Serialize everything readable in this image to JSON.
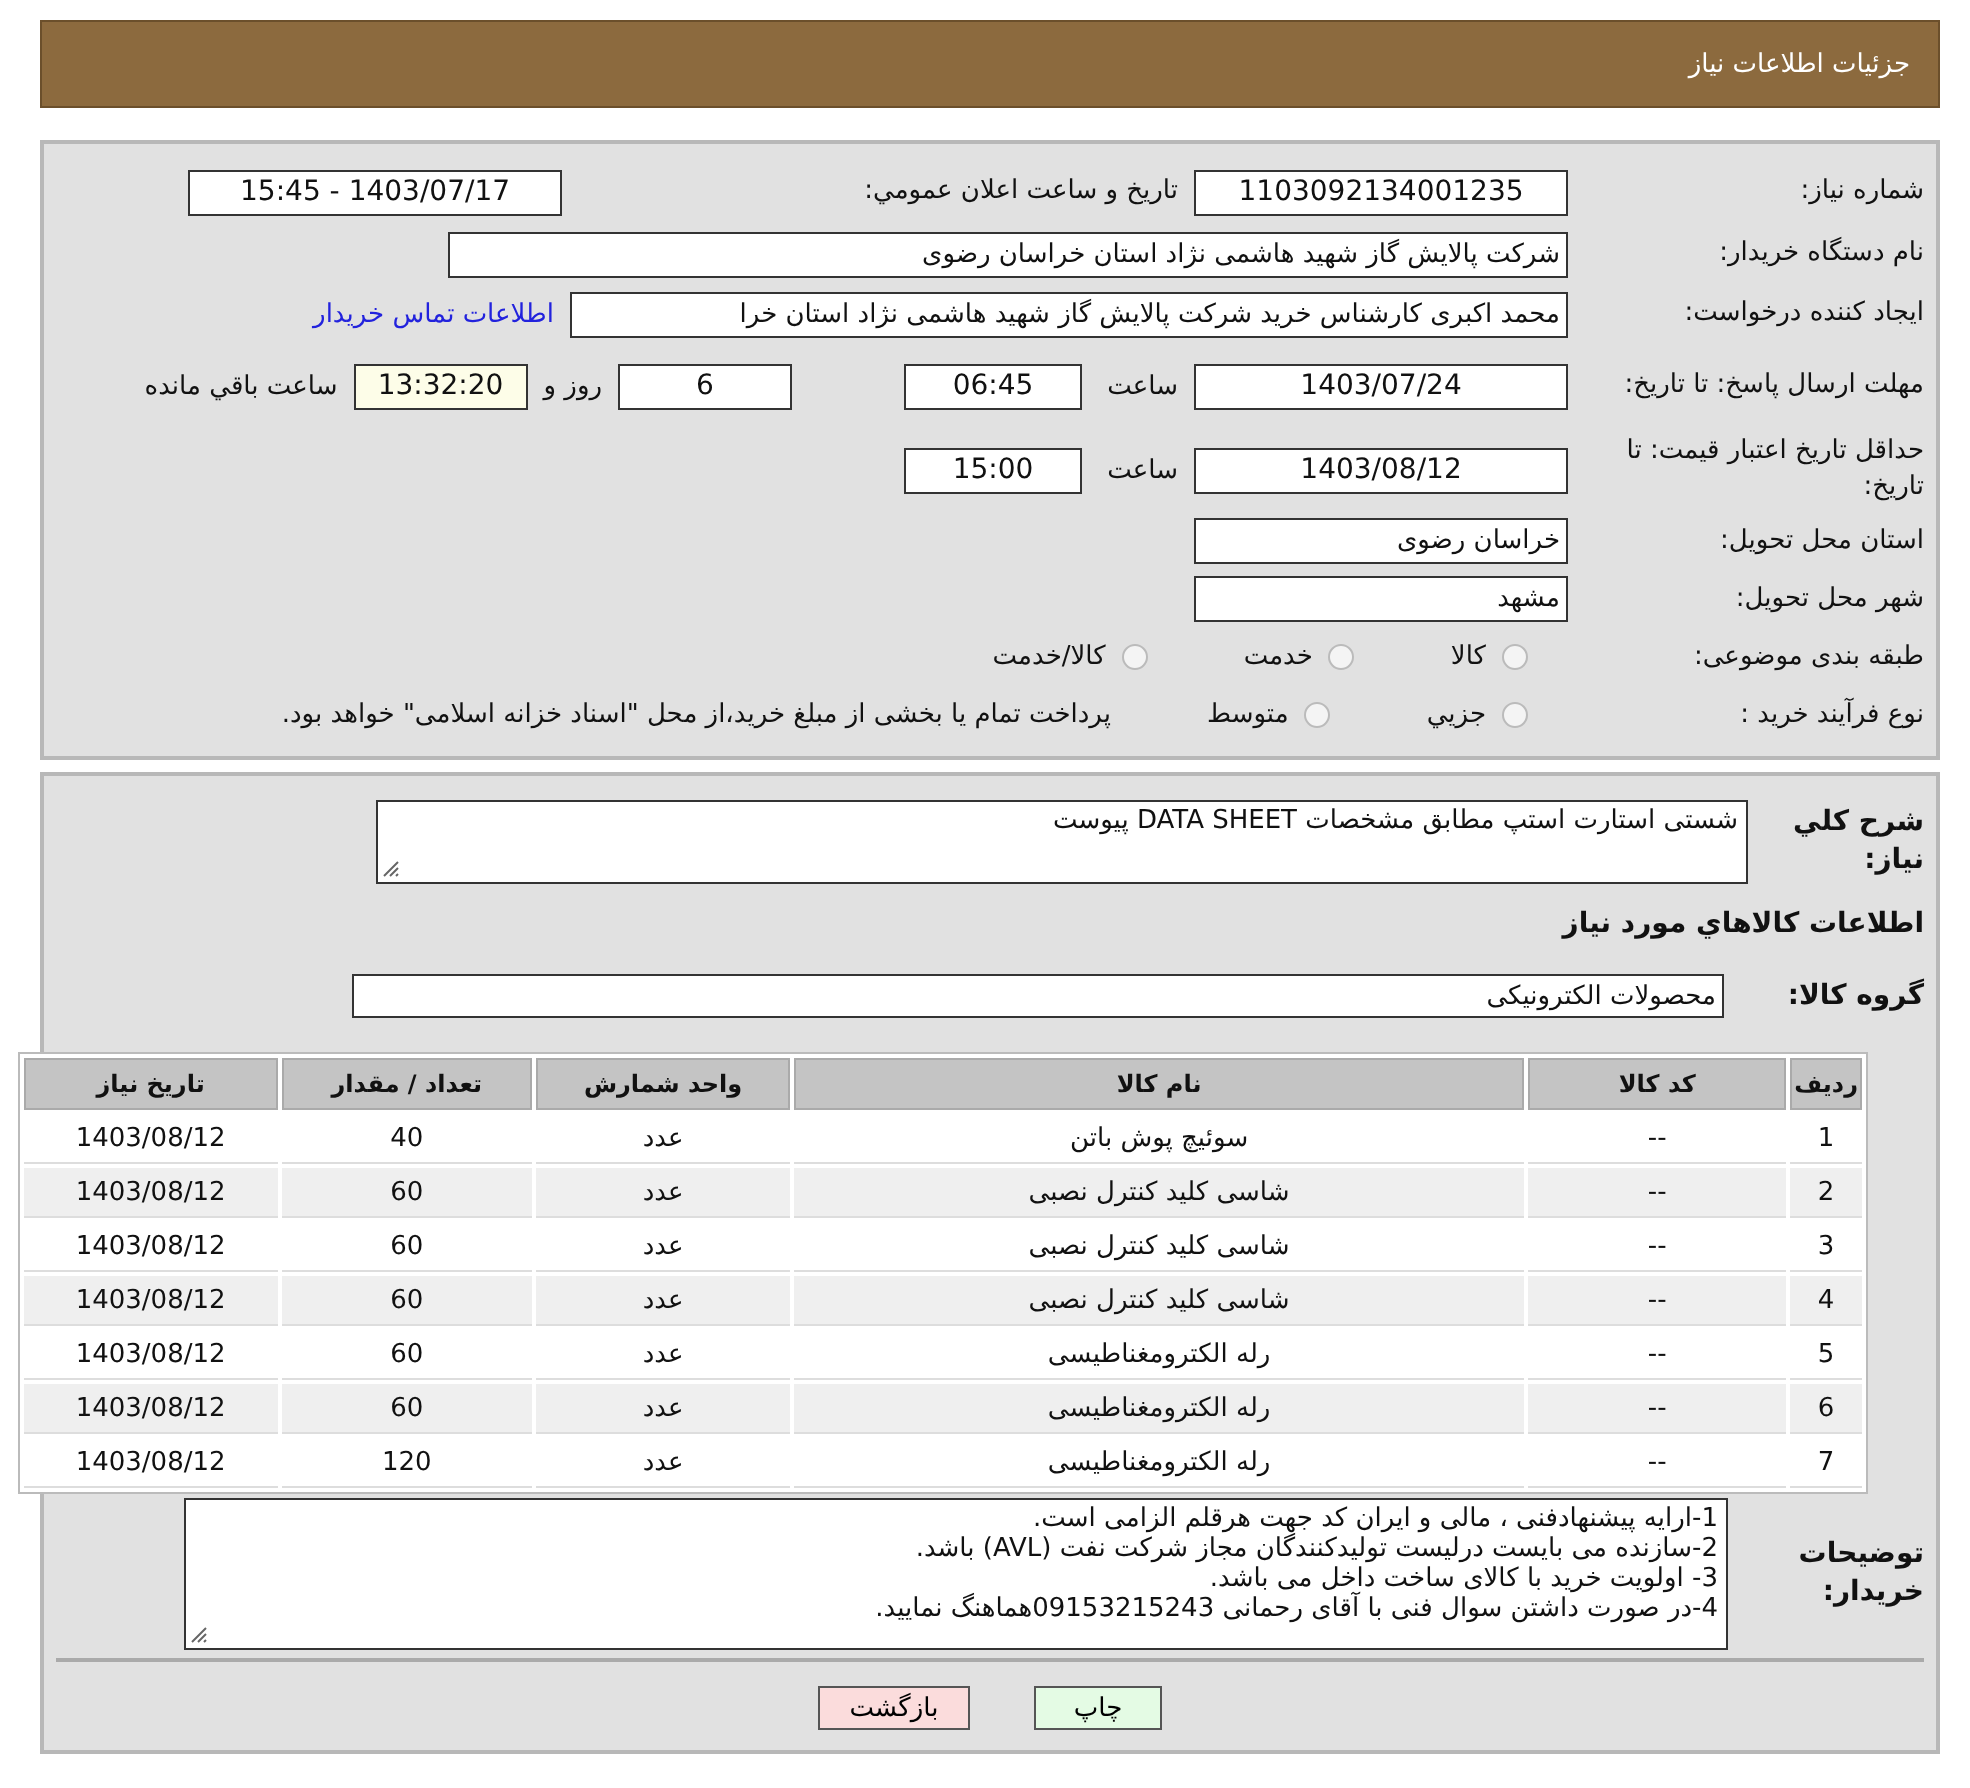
{
  "header": {
    "title": "جزئيات اطلاعات نياز"
  },
  "details": {
    "need_number": {
      "label": "شماره نیاز:",
      "value": "1103092134001235"
    },
    "announce": {
      "label": "تاريخ و ساعت اعلان عمومي:",
      "value": "1403/07/17 - 15:45"
    },
    "buyer": {
      "label": "نام دستگاه خریدار:",
      "value": "شرکت پالایش گاز شهید هاشمی نژاد   استان خراسان رضوی"
    },
    "creator": {
      "label": "ایجاد کننده درخواست:",
      "value": "محمد اکبری کارشناس خرید شرکت پالایش گاز شهید هاشمی نژاد   استان خرا",
      "link": "اطلاعات تماس خریدار"
    },
    "deadline": {
      "label": "مهلت ارسال پاسخ: تا تاریخ:",
      "date": "1403/07/24",
      "time_label": "ساعت",
      "time": "06:45",
      "days": "6",
      "days_label": "روز و",
      "remaining": "13:32:20",
      "remaining_label": "ساعت باقي مانده"
    },
    "validity": {
      "label": "حداقل تاریخ اعتبار قیمت: تا تاریخ:",
      "date": "1403/08/12",
      "time_label": "ساعت",
      "time": "15:00"
    },
    "province": {
      "label": "استان محل تحویل:",
      "value": "خراسان رضوی"
    },
    "city": {
      "label": "شهر محل تحویل:",
      "value": "مشهد"
    },
    "category": {
      "label": "طبقه بندی موضوعی:",
      "options": [
        {
          "label": "کالا",
          "selected": false
        },
        {
          "label": "خدمت",
          "selected": false
        },
        {
          "label": "کالا/خدمت",
          "selected": false
        }
      ]
    },
    "process": {
      "label": "نوع فرآیند خرید :",
      "options": [
        {
          "label": "جزيي",
          "selected": false
        },
        {
          "label": "متوسط",
          "selected": false
        }
      ],
      "note": "پرداخت تمام یا بخشی از مبلغ خرید،از محل \"اسناد خزانه اسلامی\" خواهد بود."
    }
  },
  "summary": {
    "label": "شرح کلي نياز:",
    "value": "شستی استارت استپ مطابق مشخصات DATA SHEET پیوست"
  },
  "goods_title": "اطلاعات کالاهاي مورد نياز",
  "group": {
    "label": "گروه کالا:",
    "value": "محصولات الکترونیکی"
  },
  "table": {
    "columns": [
      "ردیف",
      "کد کالا",
      "نام کالا",
      "واحد شمارش",
      "تعداد / مقدار",
      "تاریخ نیاز"
    ],
    "rows": [
      [
        "1",
        "--",
        "سوئیچ پوش باتن",
        "عدد",
        "40",
        "1403/08/12"
      ],
      [
        "2",
        "--",
        "شاسی کلید کنترل نصبی",
        "عدد",
        "60",
        "1403/08/12"
      ],
      [
        "3",
        "--",
        "شاسی کلید کنترل نصبی",
        "عدد",
        "60",
        "1403/08/12"
      ],
      [
        "4",
        "--",
        "شاسی کلید کنترل نصبی",
        "عدد",
        "60",
        "1403/08/12"
      ],
      [
        "5",
        "--",
        "رله الکترومغناطیسی",
        "عدد",
        "60",
        "1403/08/12"
      ],
      [
        "6",
        "--",
        "رله الکترومغناطیسی",
        "عدد",
        "60",
        "1403/08/12"
      ],
      [
        "7",
        "--",
        "رله الکترومغناطیسی",
        "عدد",
        "120",
        "1403/08/12"
      ]
    ]
  },
  "buyer_notes": {
    "label": "توضیحات خریدار:",
    "lines": [
      "1-ارایه پیشنهادفنی ، مالی و ایران کد جهت هرقلم الزامی است.",
      "2-سازنده می بایست درلیست تولیدکنندگان مجاز شرکت نفت (AVL)  باشد.",
      "3- اولویت خرید  با کالای ساخت  داخل می باشد.",
      "4-در صورت داشتن سوال فنی با آقای رحمانی 09153215243هماهنگ نمایید."
    ]
  },
  "buttons": [
    {
      "label": "چاپ",
      "kind": "print"
    },
    {
      "label": "بازگشت",
      "kind": "back"
    }
  ]
}
